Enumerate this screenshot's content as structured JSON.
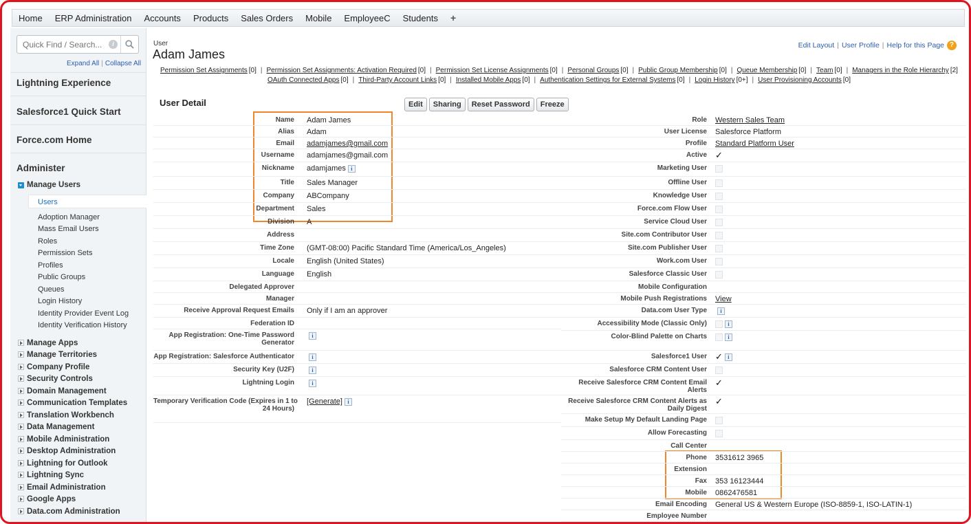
{
  "topnav": {
    "tabs": [
      "Home",
      "ERP Administration",
      "Accounts",
      "Products",
      "Sales Orders",
      "Mobile",
      "EmployeeC",
      "Students",
      "+"
    ]
  },
  "sidebar": {
    "search_placeholder": "Quick Find / Search...",
    "expand_all": "Expand All",
    "collapse_all": "Collapse All",
    "headers": [
      "Lightning Experience",
      "Salesforce1 Quick Start",
      "Force.com Home",
      "Administer"
    ],
    "manage_users": "Manage Users",
    "users_selected": "Users",
    "manage_users_items": [
      "Adoption Manager",
      "Mass Email Users",
      "Roles",
      "Permission Sets",
      "Profiles",
      "Public Groups",
      "Queues",
      "Login History",
      "Identity Provider Event Log",
      "Identity Verification History"
    ],
    "groups": [
      "Manage Apps",
      "Manage Territories",
      "Company Profile",
      "Security Controls",
      "Domain Management",
      "Communication Templates",
      "Translation Workbench",
      "Data Management",
      "Mobile Administration",
      "Desktop Administration",
      "Lightning for Outlook",
      "Lightning Sync",
      "Email Administration",
      "Google Apps",
      "Data.com Administration"
    ]
  },
  "header": {
    "crumb": "User",
    "title": "Adam James",
    "edit_layout": "Edit Layout",
    "user_profile": "User Profile",
    "help": "Help for this Page"
  },
  "related_links": [
    [
      "Permission Set Assignments",
      "[0]"
    ],
    [
      "Permission Set Assignments: Activation Required",
      "[0]"
    ],
    [
      "Permission Set License Assignments",
      "[0]"
    ],
    [
      "Personal Groups",
      "[0]"
    ],
    [
      "Public Group Membership",
      "[0]"
    ],
    [
      "Queue Membership",
      "[0]"
    ],
    [
      "Team",
      "[0]"
    ],
    [
      "Managers in the Role Hierarchy",
      "[2]"
    ],
    [
      "OAuth Connected Apps",
      "[0]"
    ],
    [
      "Third-Party Account Links",
      "[0]"
    ],
    [
      "Installed Mobile Apps",
      "[0]"
    ],
    [
      "Authentication Settings for External Systems",
      "[0]"
    ],
    [
      "Login History",
      "[0+]"
    ],
    [
      "User Provisioning Accounts",
      "[0]"
    ]
  ],
  "detail": {
    "section_title": "User Detail",
    "buttons": [
      "Edit",
      "Sharing",
      "Reset Password",
      "Freeze"
    ],
    "left": [
      {
        "label": "Name",
        "value": "Adam James"
      },
      {
        "label": "Alias",
        "value": "Adam"
      },
      {
        "label": "Email",
        "value": "adamjames@gmail.com",
        "link": true
      },
      {
        "label": "Username",
        "value": "adamjames@gmail.com"
      },
      {
        "label": "Nickname",
        "value": "adamjames",
        "info": true
      },
      {
        "label": "Title",
        "value": "Sales Manager"
      },
      {
        "label": "Company",
        "value": "ABCompany"
      },
      {
        "label": "Department",
        "value": "Sales"
      },
      {
        "label": "Division",
        "value": "A"
      },
      {
        "label": "Address",
        "value": ""
      },
      {
        "label": "Time Zone",
        "value": "(GMT-08:00) Pacific Standard Time (America/Los_Angeles)"
      },
      {
        "label": "Locale",
        "value": "English (United States)"
      },
      {
        "label": "Language",
        "value": "English"
      },
      {
        "label": "Delegated Approver",
        "value": ""
      },
      {
        "label": "Manager",
        "value": ""
      },
      {
        "label": "Receive Approval Request Emails",
        "value": "Only if I am an approver"
      },
      {
        "label": "Federation ID",
        "value": ""
      },
      {
        "label": "App Registration: One-Time Password",
        "label2": "Generator",
        "value": "",
        "info": true
      },
      {
        "label": "App Registration: Salesforce Authenticator",
        "value": "",
        "info": true
      },
      {
        "label": "Security Key (U2F)",
        "value": "",
        "info": true
      },
      {
        "label": "Lightning Login",
        "value": "",
        "info": true
      },
      {
        "label": "Temporary Verification Code (Expires in 1 to",
        "label2": "24 Hours)",
        "value": "[Generate]",
        "link": true,
        "info": true
      }
    ],
    "right": [
      {
        "label": "Role",
        "value": "Western Sales Team",
        "link": true
      },
      {
        "label": "User License",
        "value": "Salesforce Platform"
      },
      {
        "label": "Profile",
        "value": "Standard Platform User",
        "link": true
      },
      {
        "label": "Active",
        "check": "checked"
      },
      {
        "label": "Marketing User",
        "check": "empty"
      },
      {
        "label": "Offline User",
        "check": "empty"
      },
      {
        "label": "Knowledge User",
        "check": "empty"
      },
      {
        "label": "Force.com Flow User",
        "check": "empty"
      },
      {
        "label": "Service Cloud User",
        "check": "empty"
      },
      {
        "label": "Site.com Contributor User",
        "check": "empty"
      },
      {
        "label": "Site.com Publisher User",
        "check": "empty"
      },
      {
        "label": "Work.com User",
        "check": "empty"
      },
      {
        "label": "Salesforce Classic User",
        "check": "empty"
      },
      {
        "label": "Mobile Configuration",
        "value": ""
      },
      {
        "label": "Mobile Push Registrations",
        "value": "View",
        "link": true
      },
      {
        "label": "Data.com User Type",
        "value": "",
        "info": true
      },
      {
        "label": "Accessibility Mode (Classic Only)",
        "check": "empty",
        "info": true
      },
      {
        "label": "Color-Blind Palette on Charts",
        "check": "empty",
        "info": true
      },
      {
        "label": "Salesforce1 User",
        "check": "checked",
        "info": true
      },
      {
        "label": "Salesforce CRM Content User",
        "check": "empty"
      },
      {
        "label": "Receive Salesforce CRM Content Email",
        "label2": "Alerts",
        "check": "checked"
      },
      {
        "label": "Receive Salesforce CRM Content Alerts as",
        "label2": "Daily Digest",
        "check": "checked"
      },
      {
        "label": "Make Setup My Default Landing Page",
        "check": "empty"
      },
      {
        "label": "Allow Forecasting",
        "check": "empty"
      },
      {
        "label": "Call Center",
        "value": ""
      },
      {
        "label": "Phone",
        "value": "3531612 3965"
      },
      {
        "label": "Extension",
        "value": ""
      },
      {
        "label": "Fax",
        "value": "353 16123444"
      },
      {
        "label": "Mobile",
        "value": "0862476581"
      },
      {
        "label": "Email Encoding",
        "value": "General US & Western Europe (ISO-8859-1, ISO-LATIN-1)"
      },
      {
        "label": "Employee Number",
        "value": ""
      }
    ]
  },
  "colors": {
    "highlight": "#f0862a",
    "frame": "#e0141e",
    "link": "#2a5db0"
  }
}
